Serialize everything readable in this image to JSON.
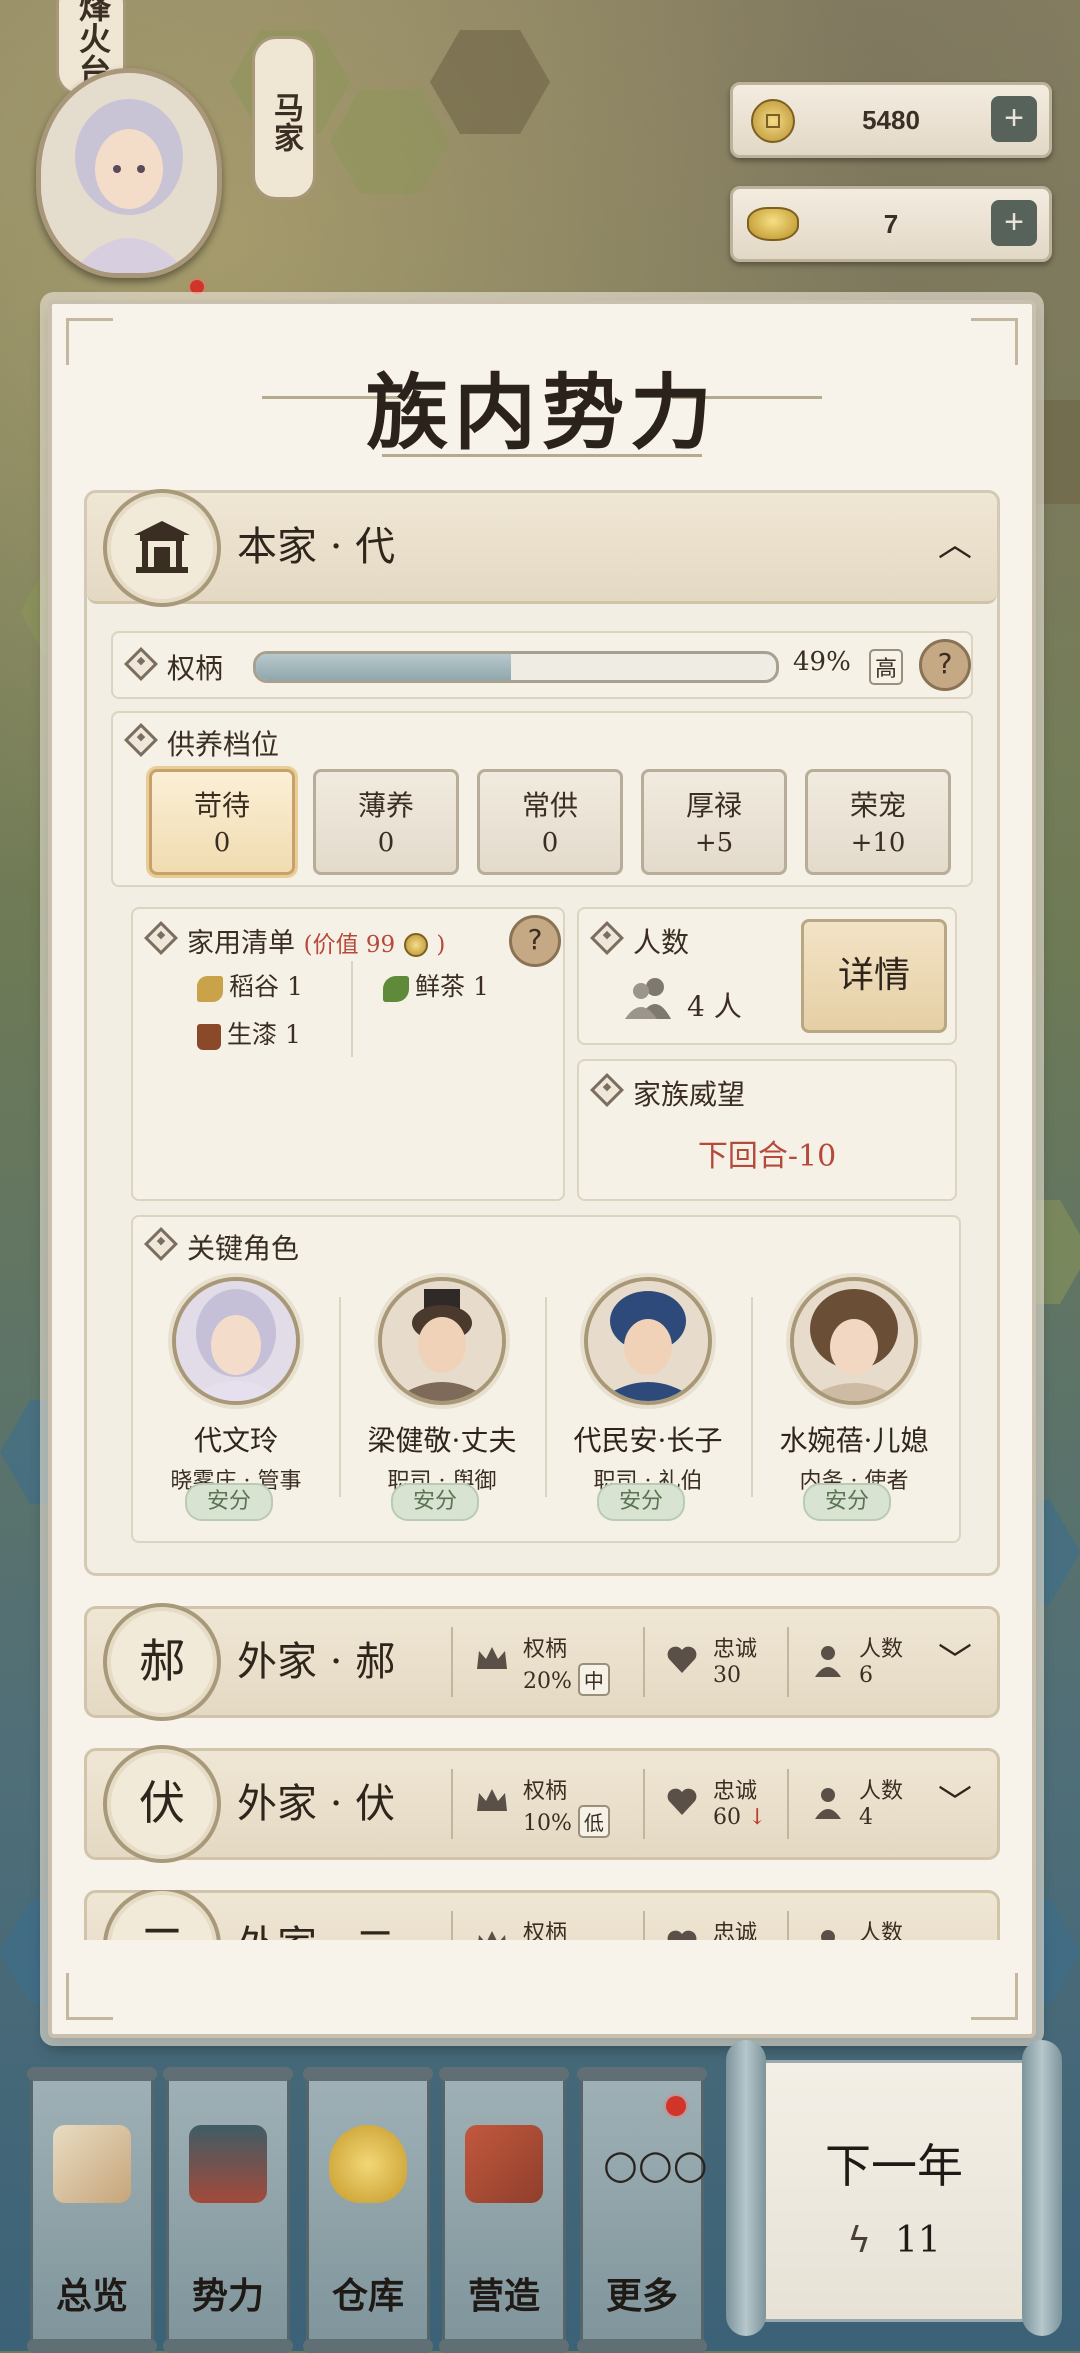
{
  "map": {
    "sign_left": "烽火台",
    "sign_mid": "马家"
  },
  "resources": [
    {
      "icon": "copper-coin-icon",
      "value": "5480"
    },
    {
      "icon": "gold-ingot-icon",
      "value": "7"
    }
  ],
  "panel": {
    "title": "族内势力",
    "main_house": {
      "emblem_icon": "ancestral-hall-icon",
      "name": "本家 · 代",
      "power": {
        "label": "权柄",
        "percent": 49,
        "percent_text": "49%",
        "level": "高"
      },
      "tiers": {
        "label": "供养档位",
        "items": [
          {
            "name": "苛待",
            "value": "0",
            "selected": true
          },
          {
            "name": "薄养",
            "value": "0",
            "selected": false
          },
          {
            "name": "常供",
            "value": "0",
            "selected": false
          },
          {
            "name": "厚禄",
            "value": "+5",
            "selected": false
          },
          {
            "name": "荣宠",
            "value": "+10",
            "selected": false
          }
        ]
      },
      "household": {
        "label": "家用清单",
        "worth": "(价值 99",
        "worth_close": ")",
        "items": [
          {
            "icon": "rice-icon",
            "text": "稻谷 1"
          },
          {
            "icon": "tea-icon",
            "text": "鲜茶 1"
          },
          {
            "icon": "lacquer-bucket-icon",
            "text": "生漆 1"
          }
        ]
      },
      "population": {
        "label": "人数",
        "value": "4 人",
        "details_button": "详情"
      },
      "prestige": {
        "label": "家族威望",
        "value": "下回合-10"
      },
      "key_roles": {
        "label": "关键角色",
        "characters": [
          {
            "name": "代文玲",
            "role": "晓雾庄 · 管事",
            "status": "安分"
          },
          {
            "name": "梁健敬·丈夫",
            "role": "职司 · 舆御",
            "status": "安分"
          },
          {
            "name": "代民安·长子",
            "role": "职司 · 礼伯",
            "status": "安分"
          },
          {
            "name": "水婉蓓·儿媳",
            "role": "内务 · 使者",
            "status": "安分"
          }
        ]
      }
    },
    "branches": [
      {
        "emblem": "郝",
        "name": "外家 · 郝",
        "power_label": "权柄",
        "power": "20%",
        "power_level": "中",
        "loyalty_label": "忠诚",
        "loyalty": "30",
        "loyalty_trend": "",
        "pop_label": "人数",
        "pop": "6"
      },
      {
        "emblem": "伏",
        "name": "外家 · 伏",
        "power_label": "权柄",
        "power": "10%",
        "power_level": "低",
        "loyalty_label": "忠诚",
        "loyalty": "60",
        "loyalty_trend": "↓",
        "pop_label": "人数",
        "pop": "4"
      },
      {
        "emblem": "二",
        "name": "外家 · 二",
        "power_label": "权柄",
        "power": "",
        "power_level": "",
        "loyalty_label": "忠诚",
        "loyalty": "",
        "loyalty_trend": "",
        "pop_label": "人数",
        "pop": ""
      }
    ]
  },
  "bottom_nav": [
    {
      "label": "总览",
      "icon": "scroll-brush-icon"
    },
    {
      "label": "势力",
      "icon": "pavilion-icon"
    },
    {
      "label": "仓库",
      "icon": "grain-sack-icon"
    },
    {
      "label": "营造",
      "icon": "bricks-trowel-icon"
    },
    {
      "label": "更多",
      "icon": "more-dots-icon"
    }
  ],
  "next_year": {
    "label": "下一年",
    "energy": "11"
  },
  "colors": {
    "panel_bg": "#f7f3ea",
    "accent_red": "#b54a3a",
    "safe_green": "#5a7454"
  }
}
